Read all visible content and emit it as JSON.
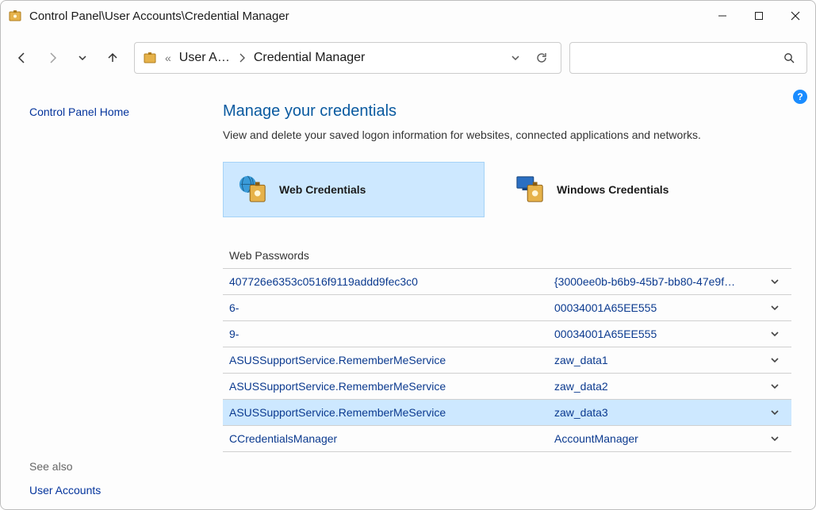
{
  "window_title": "Control Panel\\User Accounts\\Credential Manager",
  "breadcrumb": {
    "ellipsis": "«",
    "seg1": "User A…",
    "seg2": "Credential Manager"
  },
  "sidebar": {
    "cp_home": "Control Panel Home",
    "see_also": "See also",
    "user_accounts": "User Accounts"
  },
  "page": {
    "title": "Manage your credentials",
    "subtitle": "View and delete your saved logon information for websites, connected applications and networks."
  },
  "tiles": {
    "web": "Web Credentials",
    "windows": "Windows Credentials"
  },
  "section_label": "Web Passwords",
  "rows": [
    {
      "name": "407726e6353c0516f9119addd9fec3c0",
      "user": "{3000ee0b-b6b9-45b7-bb80-47e9f…",
      "selected": false
    },
    {
      "name": "6-",
      "user": "00034001A65EE555",
      "selected": false
    },
    {
      "name": "9-",
      "user": "00034001A65EE555",
      "selected": false
    },
    {
      "name": "ASUSSupportService.RememberMeService",
      "user": "zaw_data1",
      "selected": false
    },
    {
      "name": "ASUSSupportService.RememberMeService",
      "user": "zaw_data2",
      "selected": false
    },
    {
      "name": "ASUSSupportService.RememberMeService",
      "user": "zaw_data3",
      "selected": true
    },
    {
      "name": "CCredentialsManager",
      "user": "AccountManager",
      "selected": false
    }
  ]
}
